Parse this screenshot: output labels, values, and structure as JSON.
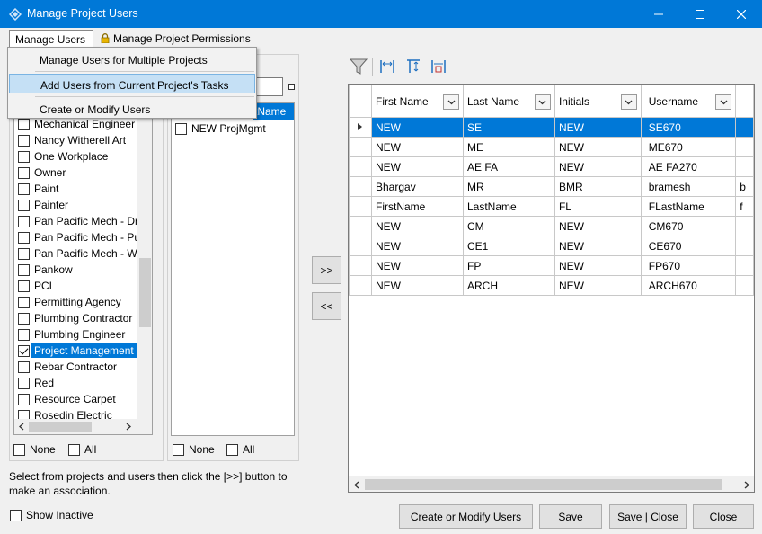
{
  "window": {
    "title": "Manage Project Users"
  },
  "tabs": {
    "manage_users": "Manage Users",
    "manage_permissions": "Manage Project Permissions"
  },
  "menu": {
    "items": [
      "Manage Users for Multiple Projects",
      "Add Users from Current Project's Tasks",
      "Create or Modify Users"
    ]
  },
  "companies": {
    "items": [
      {
        "label": "Mechanical Engineer",
        "checked": false
      },
      {
        "label": "Nancy Witherell Art",
        "checked": false
      },
      {
        "label": "One Workplace",
        "checked": false
      },
      {
        "label": "Owner",
        "checked": false
      },
      {
        "label": "Paint",
        "checked": false
      },
      {
        "label": "Painter",
        "checked": false
      },
      {
        "label": "Pan Pacific Mech - Dry",
        "checked": false
      },
      {
        "label": "Pan Pacific Mech - Pu",
        "checked": false
      },
      {
        "label": "Pan Pacific Mech - We",
        "checked": false
      },
      {
        "label": "Pankow",
        "checked": false
      },
      {
        "label": "PCI",
        "checked": false
      },
      {
        "label": "Permitting Agency",
        "checked": false
      },
      {
        "label": "Plumbing Contractor",
        "checked": false
      },
      {
        "label": "Plumbing Engineer",
        "checked": false
      },
      {
        "label": "Project Management",
        "checked": true
      },
      {
        "label": "Rebar Contractor",
        "checked": false
      },
      {
        "label": "Red",
        "checked": false
      },
      {
        "label": "Resource Carpet",
        "checked": false
      },
      {
        "label": "Rosedin Electric",
        "checked": false
      }
    ],
    "none_label": "None",
    "all_label": "All"
  },
  "users_list": {
    "header_partial": "tName",
    "items": [
      {
        "label": "NEW ProjMgmt",
        "checked": false
      }
    ],
    "none_label": "None",
    "all_label": "All"
  },
  "move_buttons": {
    "add": ">>",
    "remove": "<<"
  },
  "grid": {
    "columns": [
      "First Name",
      "Last Name",
      "Initials",
      "Username"
    ],
    "rows": [
      [
        "NEW",
        "SE",
        "NEW",
        "SE670",
        ""
      ],
      [
        "NEW",
        "ME",
        "NEW",
        "ME670",
        ""
      ],
      [
        "NEW",
        "AE FA",
        "NEW",
        "AE FA270",
        ""
      ],
      [
        "Bhargav",
        "MR",
        "BMR",
        "bramesh",
        "b"
      ],
      [
        "FirstName",
        "LastName",
        "FL",
        "FLastName",
        "f"
      ],
      [
        "NEW",
        "CM",
        "NEW",
        "CM670",
        ""
      ],
      [
        "NEW",
        "CE1",
        "NEW",
        "CE670",
        ""
      ],
      [
        "NEW",
        "FP",
        "NEW",
        "FP670",
        ""
      ],
      [
        "NEW",
        "ARCH",
        "NEW",
        "ARCH670",
        ""
      ]
    ],
    "selected_row": 0
  },
  "hint": "Select from projects and users then click the [>>] button to make an association.",
  "show_inactive": {
    "label": "Show Inactive",
    "checked": false
  },
  "footer": {
    "create_modify": "Create or Modify Users",
    "save": "Save",
    "save_close": "Save | Close",
    "close": "Close"
  },
  "colors": {
    "accent": "#0078d7",
    "menu_highlight": "#c5e0f5"
  }
}
